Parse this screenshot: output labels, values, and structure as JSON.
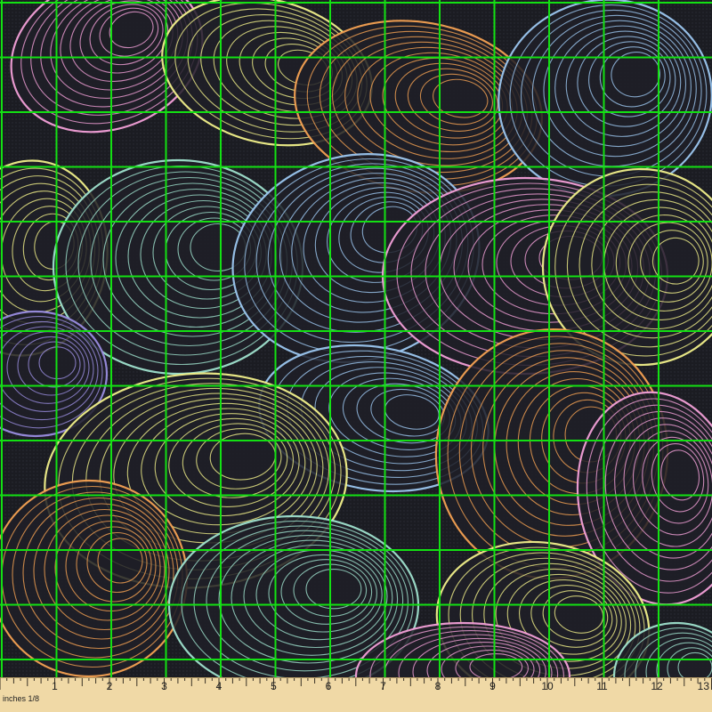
{
  "scene": {
    "subject": "patterned-fabric-swatch",
    "background_color": "#1b1c22",
    "grid_color": "#13e013",
    "motif_colors": [
      "#f3a0d8",
      "#f1f08a",
      "#9fe2ce",
      "#9cc7f0",
      "#f4a152",
      "#9a8de0"
    ]
  },
  "ruler": {
    "unit_label": "inches 1/8",
    "numbers": [
      "1",
      "2",
      "3",
      "4",
      "5",
      "6",
      "7",
      "8",
      "9",
      "10",
      "11",
      "12",
      "13"
    ],
    "background_color": "#f0d9a6"
  }
}
